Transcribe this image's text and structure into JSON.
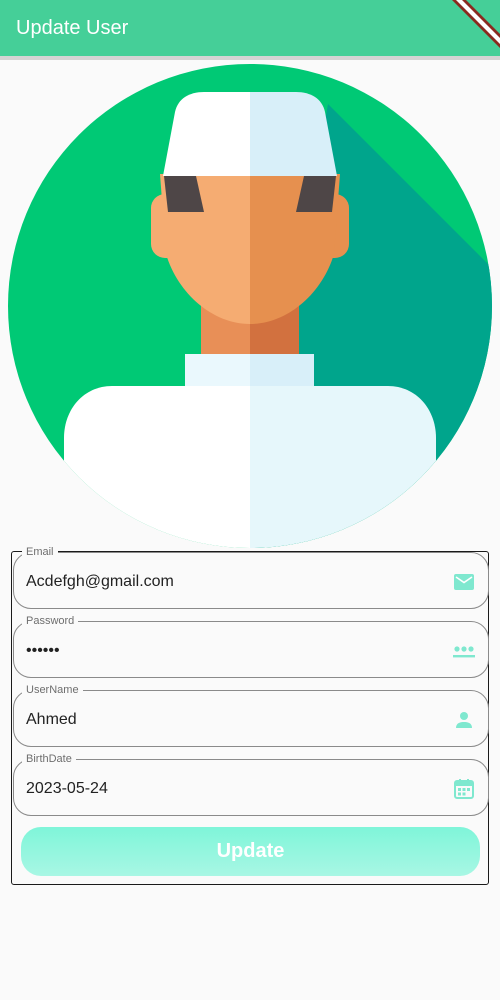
{
  "appbar": {
    "title": "Update User",
    "color": "#45cf98"
  },
  "avatar": {
    "icon": "user-avatar-illustration",
    "background_color": "#00c975"
  },
  "form": {
    "fields": [
      {
        "label": "Email",
        "value": "Acdefgh@gmail.com",
        "icon": "email-icon"
      },
      {
        "label": "Password",
        "value": "••••••",
        "icon": "password-icon"
      },
      {
        "label": "UserName",
        "value": "Ahmed",
        "icon": "person-icon"
      },
      {
        "label": "BirthDate",
        "value": "2023-05-24",
        "icon": "calendar-icon"
      }
    ],
    "icon_color": "#7fe8cf",
    "submit_label": "Update"
  }
}
